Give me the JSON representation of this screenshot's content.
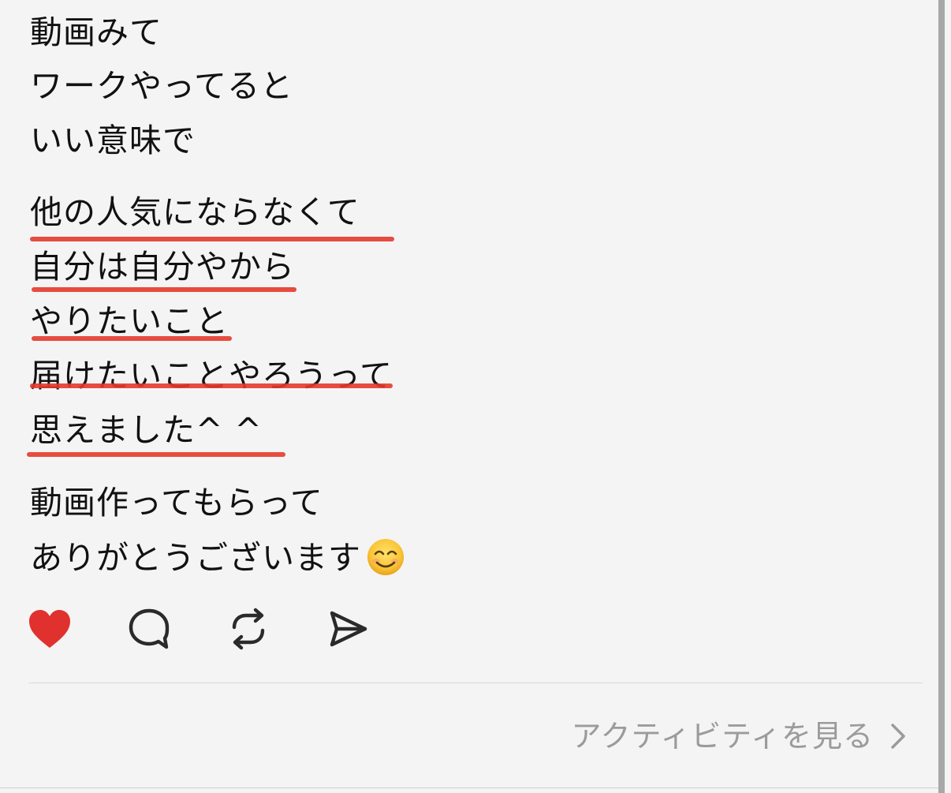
{
  "post": {
    "lines": [
      "動画みて",
      "ワークやってると",
      "いい意味で",
      "他の人気にならなくて",
      "自分は自分やから",
      "やりたいこと",
      "届けたいことやろうって",
      "思えました^ ^",
      "動画作ってもらって",
      "ありがとうございます"
    ],
    "emoji": "smiling-face-with-smiling-eyes"
  },
  "actions": {
    "like_icon": "heart-filled-icon",
    "comment_icon": "comment-bubble-icon",
    "repost_icon": "repost-icon",
    "share_icon": "send-icon",
    "like_color": "#e0312f"
  },
  "footer": {
    "activity_label": "アクティビティを見る"
  },
  "colors": {
    "underline": "#e43a2c",
    "background": "#f4f4f4",
    "muted_text": "#9b9b9b"
  }
}
